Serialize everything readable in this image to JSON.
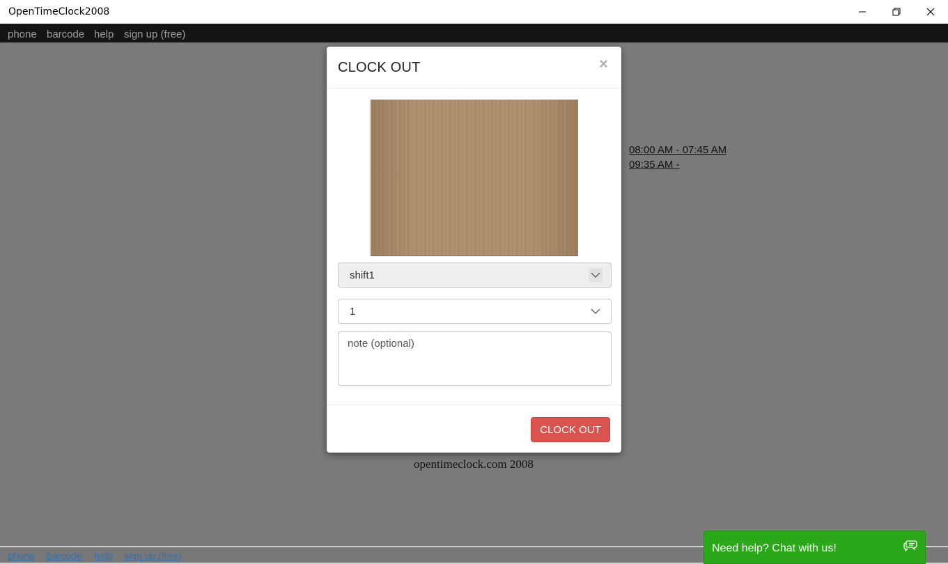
{
  "window": {
    "title": "OpenTimeClock2008"
  },
  "navbar": {
    "items": [
      "phone",
      "barcode",
      "help",
      "sign up (free)"
    ]
  },
  "background": {
    "shifts": [
      "08:00 AM - 07:45 AM",
      "09:35 AM -"
    ],
    "footer": "opentimeclock.com 2008",
    "bottom_links": [
      "phone",
      "barcode",
      "help",
      "sign up (free)"
    ]
  },
  "modal": {
    "title": "CLOCK OUT",
    "close_symbol": "×",
    "shift_select": {
      "value": "shift1"
    },
    "qty_select": {
      "value": "1"
    },
    "note": {
      "placeholder": "note (optional)"
    },
    "submit_label": "CLOCK OUT",
    "colors": {
      "submit": "#d9534f"
    }
  },
  "chat": {
    "label": "Need help? Chat with us!",
    "color": "#2aa81a",
    "icon": "chat-bubbles-icon"
  }
}
